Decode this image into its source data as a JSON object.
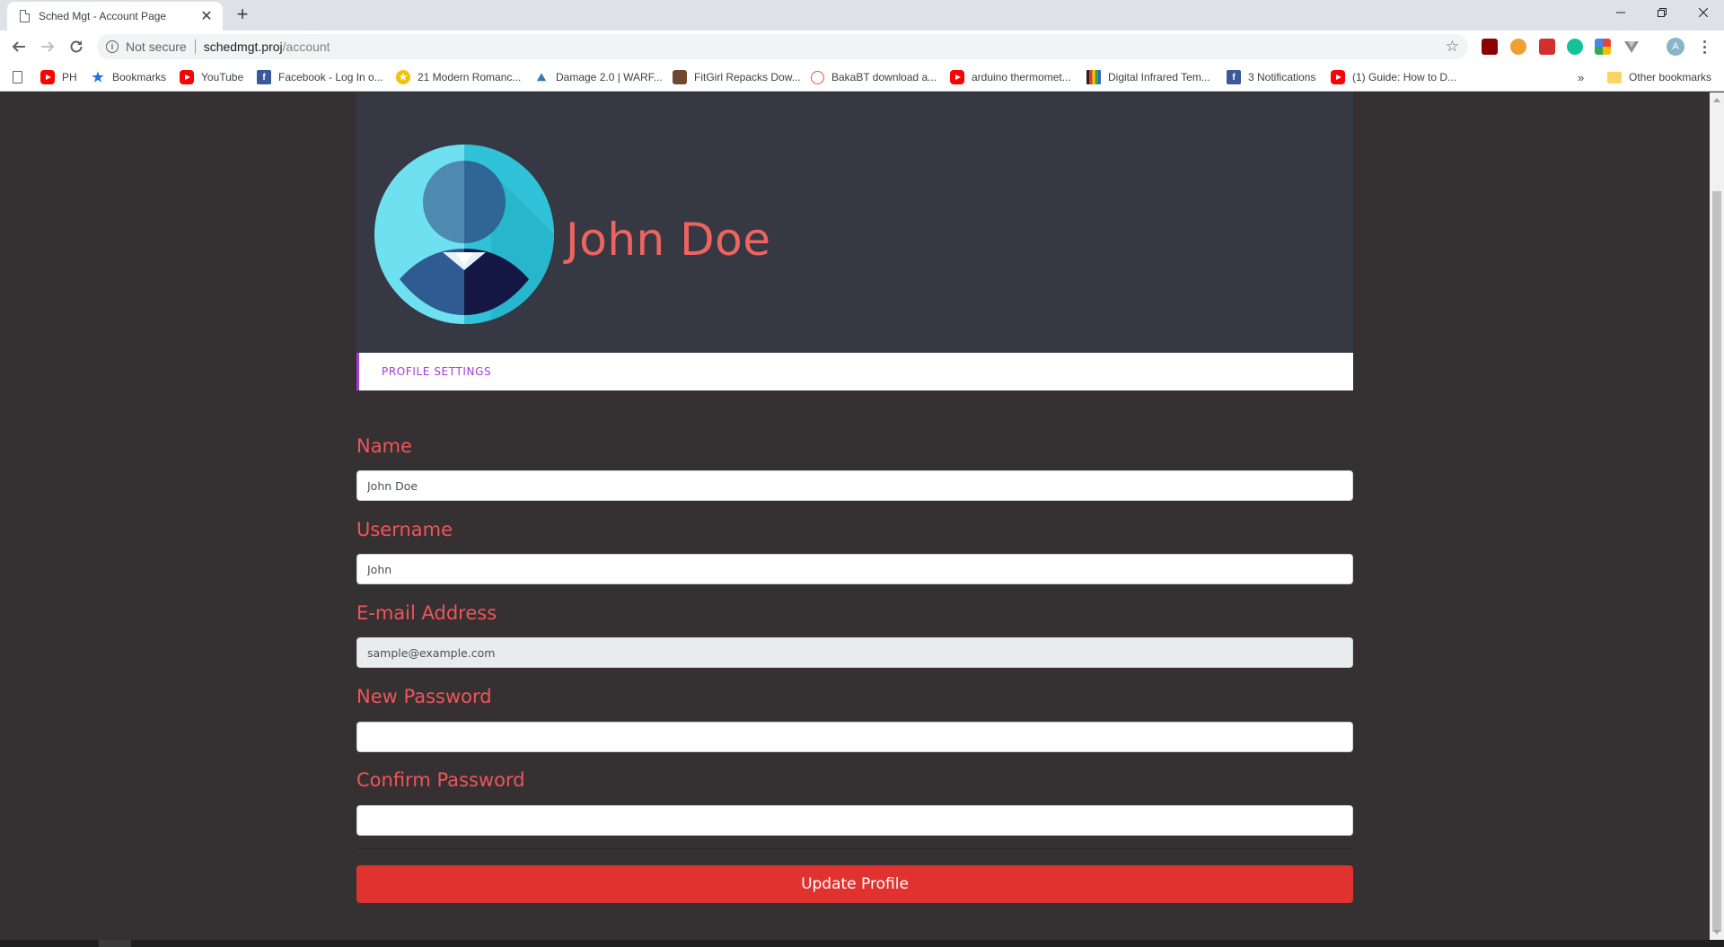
{
  "browser": {
    "tab_title": "Sched Mgt - Account Page",
    "not_secure_label": "Not secure",
    "url_host": "schedmgt.proj",
    "url_path": "/account",
    "avatar_letter": "A"
  },
  "bookmarks": {
    "items": [
      {
        "label": "PH",
        "icon": "youtube-icon"
      },
      {
        "label": "Bookmarks",
        "icon": "star-icon"
      },
      {
        "label": "YouTube",
        "icon": "youtube-icon"
      },
      {
        "label": "Facebook - Log In o...",
        "icon": "facebook-icon"
      },
      {
        "label": "21 Modern Romanc...",
        "icon": "coin-icon"
      },
      {
        "label": "Damage 2.0 | WARF...",
        "icon": "damage-icon"
      },
      {
        "label": "FitGirl Repacks Dow...",
        "icon": "fitgirl-icon"
      },
      {
        "label": "BakaBT download a...",
        "icon": "bakabt-icon"
      },
      {
        "label": "arduino thermomet...",
        "icon": "youtube-icon"
      },
      {
        "label": "Digital Infrared Tem...",
        "icon": "shop-icon"
      },
      {
        "label": "3 Notifications",
        "icon": "facebook-icon"
      },
      {
        "label": "(1) Guide: How to D...",
        "icon": "youtube-icon"
      }
    ],
    "overflow_label": "»",
    "other_label": "Other bookmarks"
  },
  "profile": {
    "name": "John Doe",
    "tab_label": "PROFILE SETTINGS"
  },
  "form": {
    "name_label": "Name",
    "name_value": "John Doe",
    "username_label": "Username",
    "username_value": "John",
    "email_label": "E-mail Address",
    "email_value": "sample@example.com",
    "new_password_label": "New Password",
    "new_password_value": "",
    "confirm_password_label": "Confirm Password",
    "confirm_password_value": "",
    "submit_label": "Update Profile"
  },
  "colors": {
    "page_bg": "#353132",
    "header_bg": "#363943",
    "accent_red": "#f0545a",
    "button_red": "#e03330",
    "tab_purple": "#a838d8"
  }
}
